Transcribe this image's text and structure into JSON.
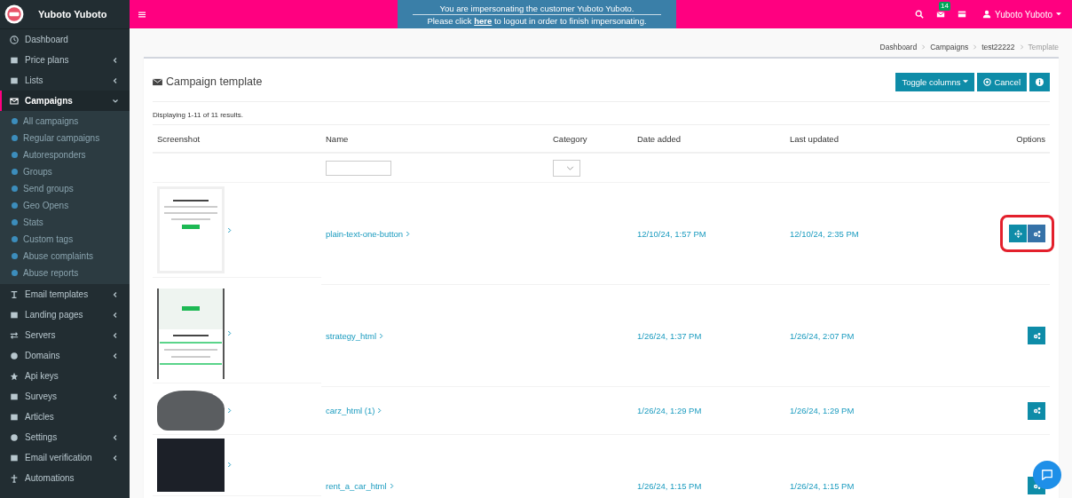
{
  "brand": {
    "name": "Yuboto Yuboto"
  },
  "impersonation": {
    "line1": "You are impersonating the customer Yuboto Yuboto.",
    "line2_before": "Please click ",
    "link": "here",
    "line2_after": " to logout in order to finish impersonating."
  },
  "topbar": {
    "badge": "14",
    "user": "Yuboto Yuboto"
  },
  "sidebar": {
    "items": [
      {
        "label": "Dashboard",
        "active": false
      },
      {
        "label": "Price plans",
        "active": false,
        "expanded": false
      },
      {
        "label": "Lists",
        "active": false,
        "expanded": false
      },
      {
        "label": "Campaigns",
        "active": true,
        "expanded": true,
        "children": [
          {
            "label": "All campaigns"
          },
          {
            "label": "Regular campaigns"
          },
          {
            "label": "Autoresponders"
          },
          {
            "label": "Groups"
          },
          {
            "label": "Send groups"
          },
          {
            "label": "Geo Opens"
          },
          {
            "label": "Stats"
          },
          {
            "label": "Custom tags"
          },
          {
            "label": "Abuse complaints"
          },
          {
            "label": "Abuse reports"
          }
        ]
      },
      {
        "label": "Email templates",
        "active": false,
        "expanded": false
      },
      {
        "label": "Landing pages",
        "active": false,
        "expanded": false
      },
      {
        "label": "Servers",
        "active": false,
        "expanded": false
      },
      {
        "label": "Domains",
        "active": false,
        "expanded": false
      },
      {
        "label": "Api keys",
        "active": false
      },
      {
        "label": "Surveys",
        "active": false,
        "expanded": false
      },
      {
        "label": "Articles",
        "active": false
      },
      {
        "label": "Settings",
        "active": false,
        "expanded": false
      },
      {
        "label": "Email verification",
        "active": false,
        "expanded": false
      },
      {
        "label": "Automations",
        "active": false
      }
    ]
  },
  "breadcrumb": [
    "Dashboard",
    "Campaigns",
    "test22222",
    "Template"
  ],
  "card": {
    "title": "Campaign template",
    "buttons": [
      "Toggle columns",
      "Cancel"
    ],
    "summary": "Displaying 1-11 of 11 results."
  },
  "table": {
    "columns": [
      "Screenshot",
      "Name",
      "Category",
      "Date added",
      "Last updated",
      "Options"
    ],
    "rows": [
      {
        "kind": "email",
        "name": "plain-text-one-button",
        "date_added": "12/10/24, 1:57 PM",
        "last_updated": "12/10/24, 2:35 PM",
        "preview": true,
        "highlighted": true
      },
      {
        "kind": "banner",
        "name": "strategy_html",
        "date_added": "1/26/24, 1:37 PM",
        "last_updated": "1/26/24, 2:07 PM",
        "preview": false,
        "highlighted": false
      },
      {
        "kind": "photo",
        "name": "carz_html (1)",
        "date_added": "1/26/24, 1:29 PM",
        "last_updated": "1/26/24, 1:29 PM",
        "preview": false,
        "highlighted": false
      },
      {
        "kind": "dark",
        "name": "rent_a_car_html",
        "date_added": "1/26/24, 1:15 PM",
        "last_updated": "1/26/24, 1:15 PM",
        "preview": false,
        "highlighted": false
      }
    ]
  }
}
